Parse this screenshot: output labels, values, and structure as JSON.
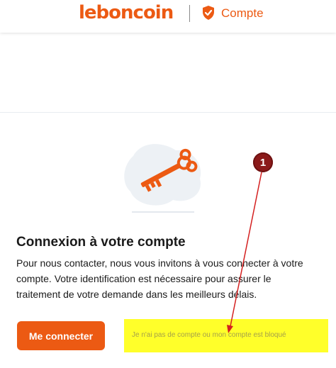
{
  "header": {
    "logo_text": "leboncoin",
    "section_label": "Compte",
    "section_icon": "shield-check-icon",
    "brand_color": "#ec5a13"
  },
  "illustration": {
    "icon": "key-icon"
  },
  "main": {
    "title": "Connexion à votre compte",
    "description": "Pour nous contacter, nous vous invitons à vous connecter à votre compte. Votre identification est nécessaire pour assurer le traitement de votre demande dans les meilleurs délais.",
    "login_button_label": "Me connecter",
    "no_account_link": "Je n'ai pas de compte ou mon compte est bloqué"
  },
  "annotation": {
    "badge_number": "1",
    "highlight_color": "#ffff2a",
    "arrow_color": "#d42020"
  }
}
